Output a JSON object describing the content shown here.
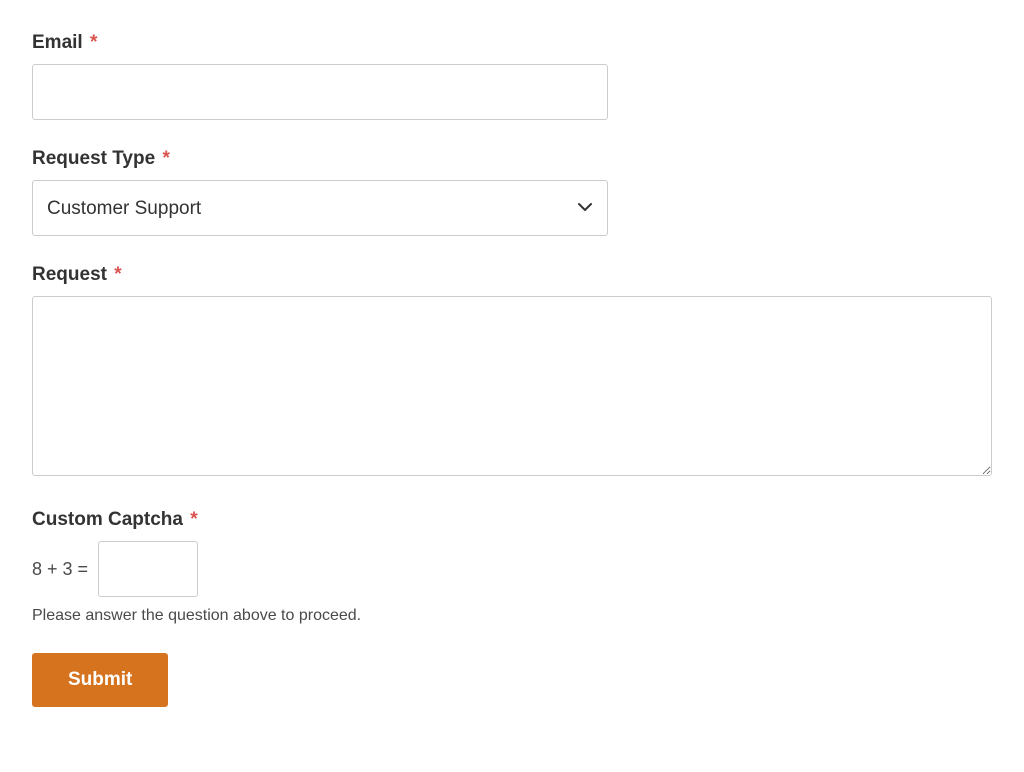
{
  "form": {
    "email": {
      "label": "Email",
      "value": ""
    },
    "request_type": {
      "label": "Request Type",
      "selected": "Customer Support"
    },
    "request": {
      "label": "Request",
      "value": ""
    },
    "captcha": {
      "label": "Custom Captcha",
      "question": "8 + 3 =",
      "value": "",
      "hint": "Please answer the question above to proceed."
    },
    "submit_label": "Submit",
    "required_mark": "*"
  }
}
